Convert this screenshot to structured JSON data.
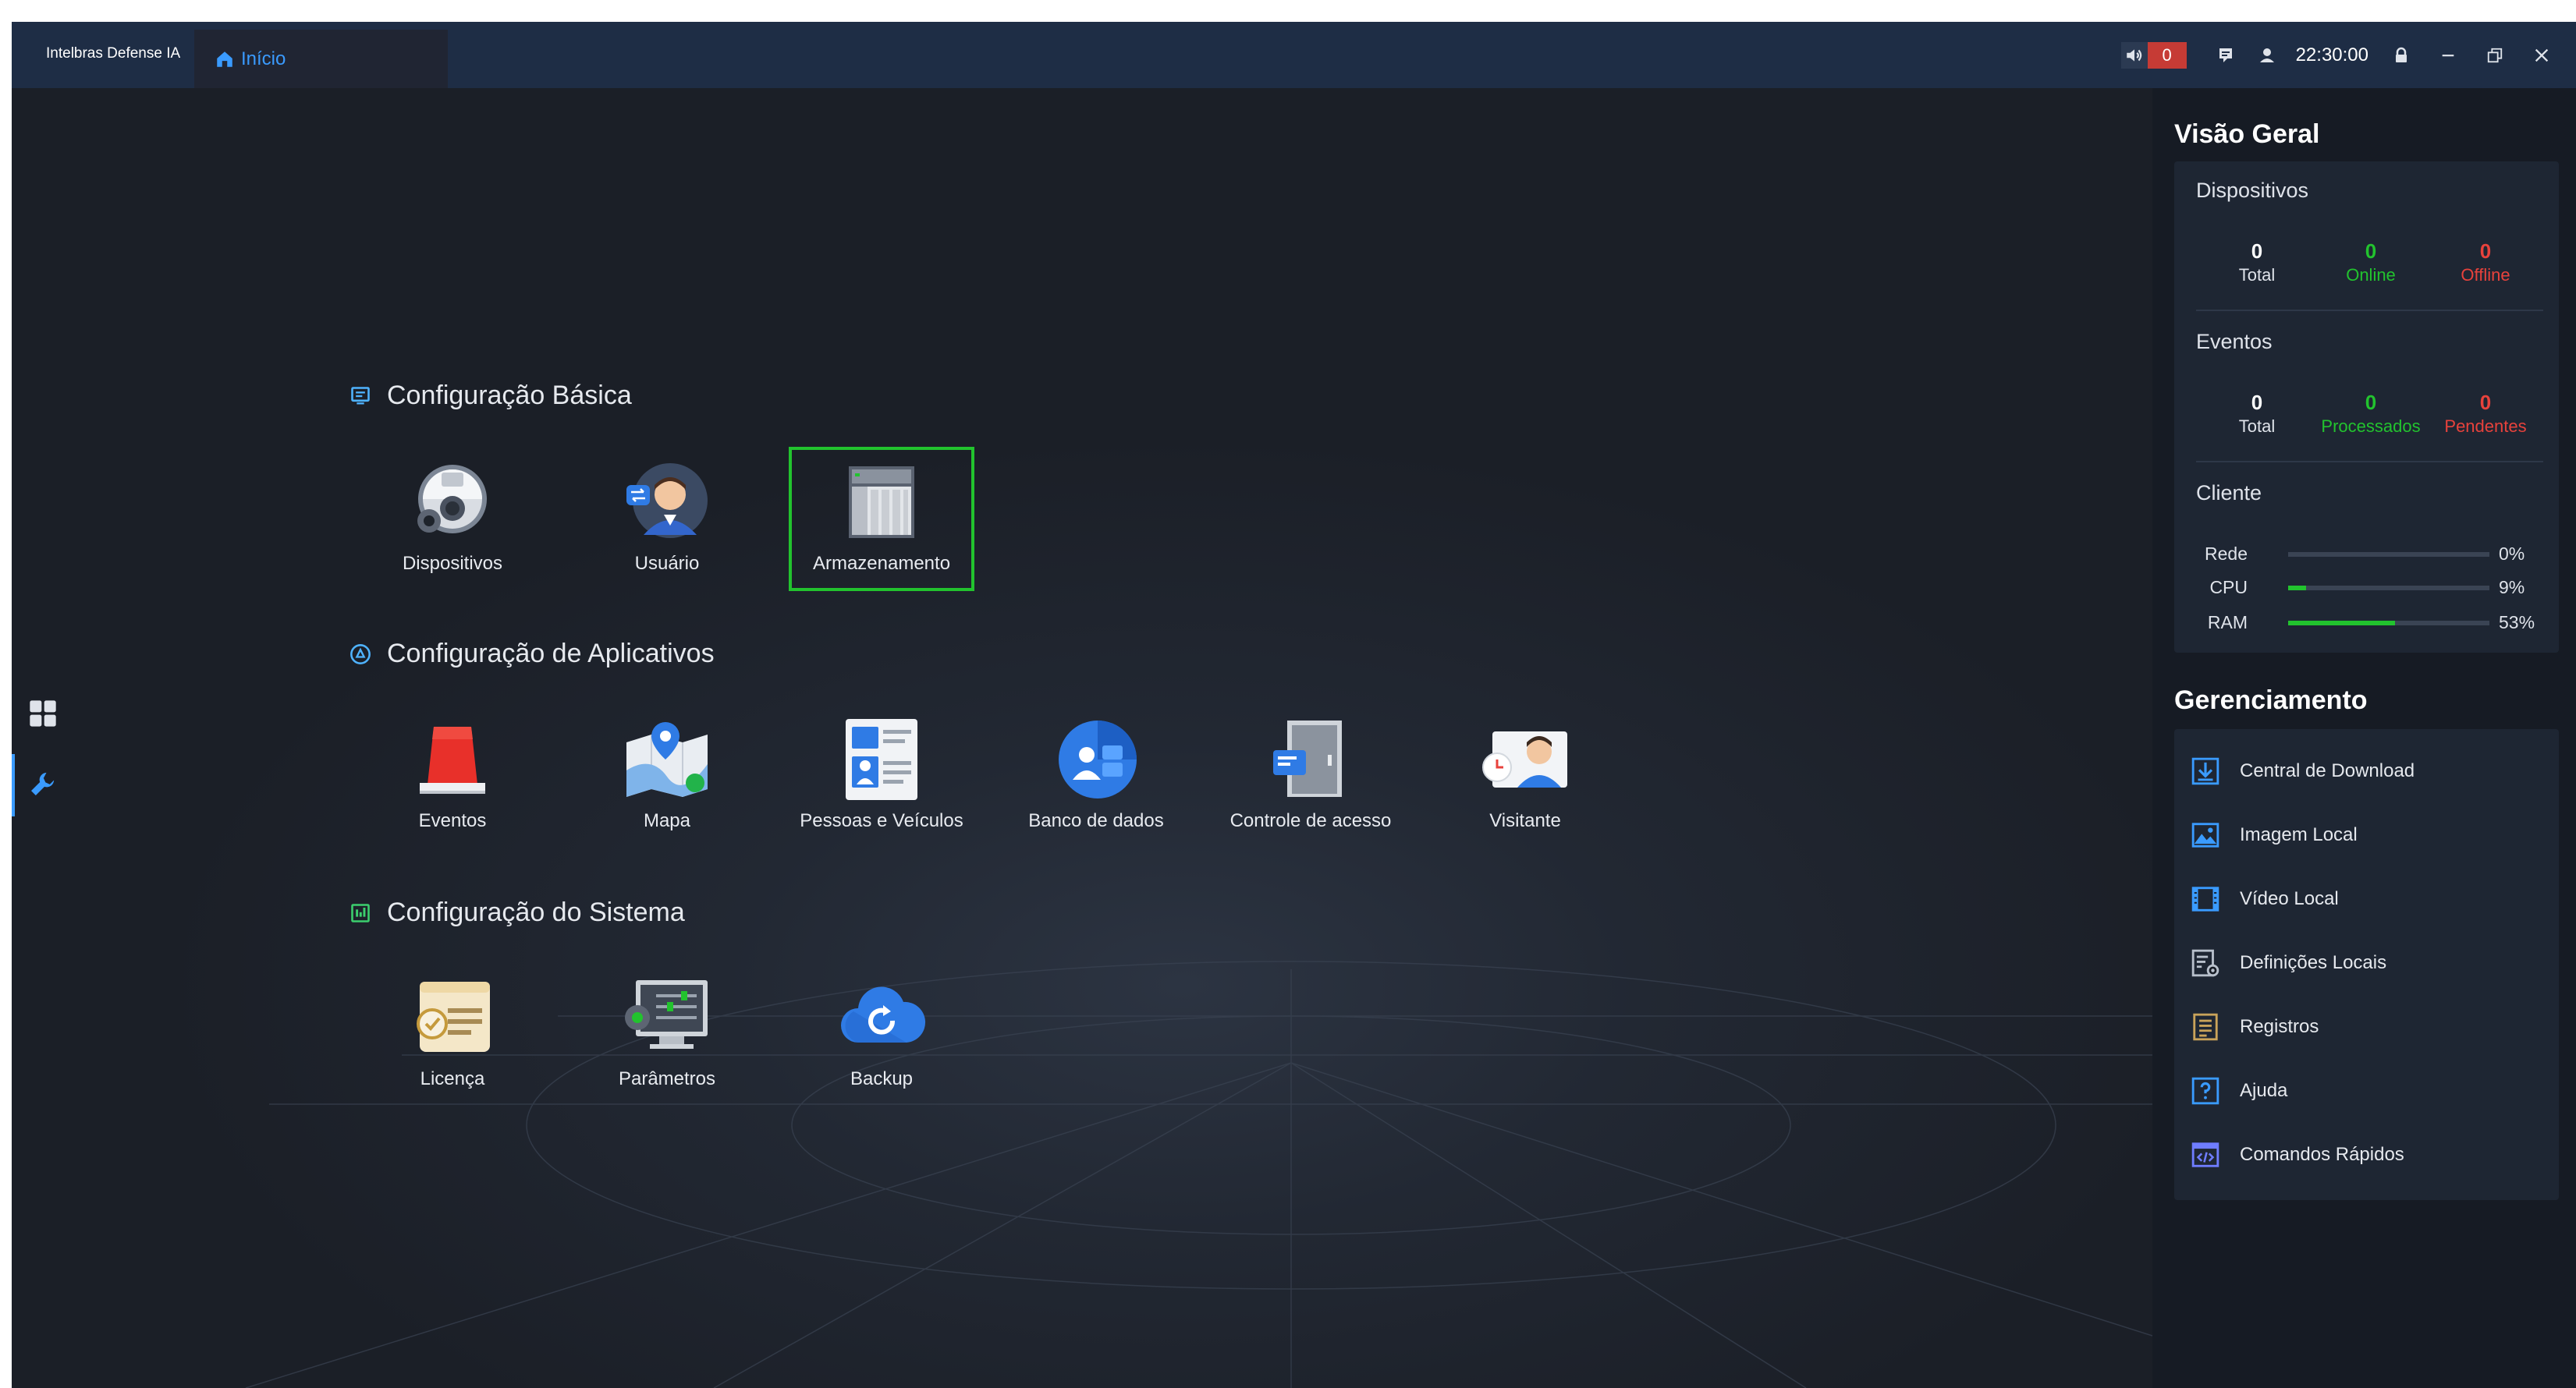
{
  "titlebar": {
    "app_title": "Intelbras Defense IA",
    "home_tab": "Início",
    "alarm_count": "0",
    "time": "22:30:00",
    "icons": [
      "sound-icon",
      "message-icon",
      "user-icon",
      "lock-icon",
      "minimize-icon",
      "restore-icon",
      "close-icon"
    ]
  },
  "rail": {
    "items": [
      "apps-grid-icon",
      "wrench-icon"
    ],
    "active": "wrench-icon"
  },
  "sections": {
    "basic": {
      "title": "Configuração Básica",
      "items": [
        {
          "label": "Dispositivos",
          "icon": "devices-icon"
        },
        {
          "label": "Usuário",
          "icon": "user-icon"
        },
        {
          "label": "Armazenamento",
          "icon": "storage-icon",
          "selected": true
        }
      ]
    },
    "apps": {
      "title": "Configuração de Aplicativos",
      "items": [
        {
          "label": "Eventos",
          "icon": "alarm-light-icon"
        },
        {
          "label": "Mapa",
          "icon": "map-icon"
        },
        {
          "label": "Pessoas e Veículos",
          "icon": "person-card-icon"
        },
        {
          "label": "Banco de dados",
          "icon": "database-icon"
        },
        {
          "label": "Controle de acesso",
          "icon": "door-icon"
        },
        {
          "label": "Visitante",
          "icon": "visitor-icon"
        }
      ]
    },
    "system": {
      "title": "Configuração do Sistema",
      "items": [
        {
          "label": "Licença",
          "icon": "license-icon"
        },
        {
          "label": "Parâmetros",
          "icon": "parameters-icon"
        },
        {
          "label": "Backup",
          "icon": "cloud-backup-icon"
        }
      ]
    }
  },
  "overview": {
    "title": "Visão Geral",
    "devices": {
      "title": "Dispositivos",
      "total": {
        "value": "0",
        "label": "Total"
      },
      "online": {
        "value": "0",
        "label": "Online"
      },
      "offline": {
        "value": "0",
        "label": "Offline"
      }
    },
    "events": {
      "title": "Eventos",
      "total": {
        "value": "0",
        "label": "Total"
      },
      "processed": {
        "value": "0",
        "label": "Processados"
      },
      "pending": {
        "value": "0",
        "label": "Pendentes"
      }
    },
    "client": {
      "title": "Cliente",
      "meters": [
        {
          "label": "Rede",
          "value": "0%",
          "fraction": 0.0
        },
        {
          "label": "CPU",
          "value": "9%",
          "fraction": 0.09
        },
        {
          "label": "RAM",
          "value": "53%",
          "fraction": 0.53
        }
      ]
    }
  },
  "management": {
    "title": "Gerenciamento",
    "items": [
      {
        "label": "Central de Download",
        "icon": "download-icon"
      },
      {
        "label": "Imagem Local",
        "icon": "image-icon"
      },
      {
        "label": "Vídeo Local",
        "icon": "video-icon"
      },
      {
        "label": "Definições Locais",
        "icon": "settings-doc-icon"
      },
      {
        "label": "Registros",
        "icon": "log-icon"
      },
      {
        "label": "Ajuda",
        "icon": "help-icon"
      },
      {
        "label": "Comandos Rápidos",
        "icon": "code-icon"
      }
    ]
  },
  "colors": {
    "accent": "#3a9bff",
    "online": "#22c32e",
    "offline": "#e8423c",
    "selected_outline": "#22c32e"
  }
}
